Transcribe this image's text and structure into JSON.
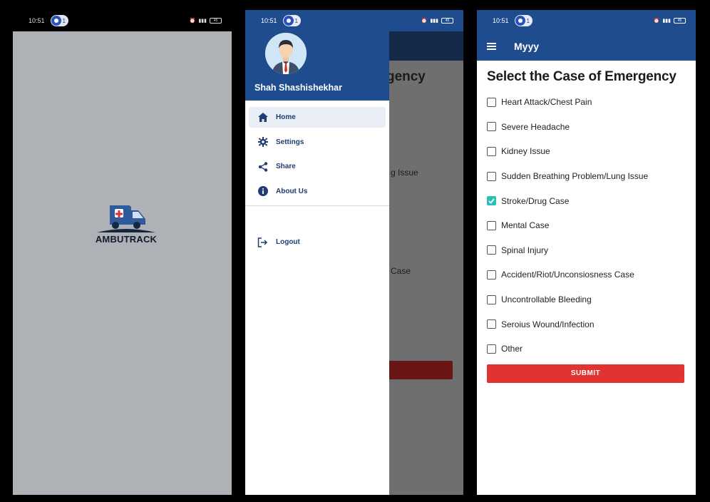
{
  "status_bar": {
    "time": "10:51",
    "notification_count": "1",
    "battery": "45"
  },
  "splash": {
    "brand": "AMBUTRACK"
  },
  "drawer": {
    "user_name": "Shah Shashishekhar",
    "items": [
      {
        "label": "Home",
        "icon": "home-icon",
        "active": true
      },
      {
        "label": "Settings",
        "icon": "gear-icon",
        "active": false
      },
      {
        "label": "Share",
        "icon": "share-icon",
        "active": false
      },
      {
        "label": "About Us",
        "icon": "info-icon",
        "active": false
      }
    ],
    "logout_label": "Logout"
  },
  "behind_drawer": {
    "title_fragment": "ergency",
    "line_fragments": [
      "g Issue",
      "Case"
    ]
  },
  "app": {
    "title": "Myyy",
    "heading": "Select the Case of Emergency",
    "options": [
      {
        "label": "Heart Attack/Chest Pain",
        "checked": false
      },
      {
        "label": "Severe Headache",
        "checked": false
      },
      {
        "label": "Kidney Issue",
        "checked": false
      },
      {
        "label": "Sudden Breathing Problem/Lung Issue",
        "checked": false
      },
      {
        "label": "Stroke/Drug Case",
        "checked": true
      },
      {
        "label": "Mental Case",
        "checked": false
      },
      {
        "label": "Spinal Injury",
        "checked": false
      },
      {
        "label": "Accident/Riot/Unconsiosness Case",
        "checked": false
      },
      {
        "label": "Uncontrollable Bleeding",
        "checked": false
      },
      {
        "label": "Seroius Wound/Infection",
        "checked": false
      },
      {
        "label": "Other",
        "checked": false
      }
    ],
    "submit_label": "SUBMIT"
  },
  "colors": {
    "primary": "#1e4c8e",
    "submit": "#e23232",
    "checkbox_checked": "#26c2b8",
    "splash_bg": "#aeb2b7"
  }
}
